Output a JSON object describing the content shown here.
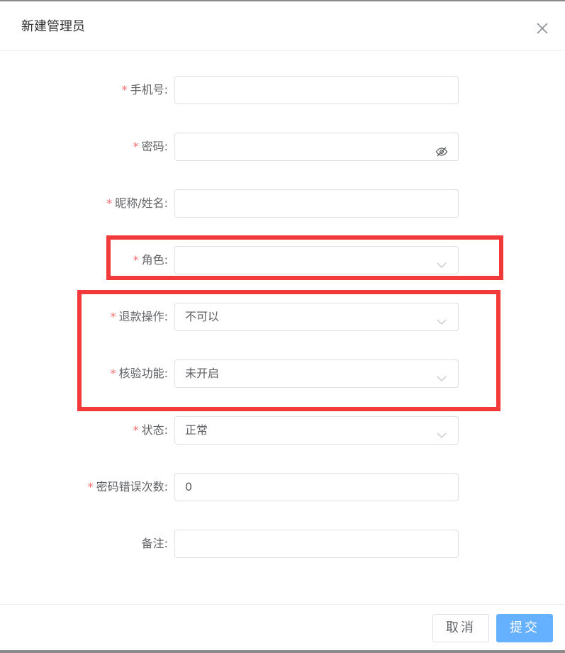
{
  "dialog": {
    "title": "新建管理员"
  },
  "form": {
    "phone": {
      "label": "手机号:",
      "required": true,
      "value": ""
    },
    "password": {
      "label": "密码:",
      "required": true,
      "value": ""
    },
    "nickname": {
      "label": "昵称/姓名:",
      "required": true,
      "value": ""
    },
    "role": {
      "label": "角色:",
      "required": true,
      "value": ""
    },
    "refund": {
      "label": "退款操作:",
      "required": true,
      "value": "不可以"
    },
    "verify": {
      "label": "核验功能:",
      "required": true,
      "value": "未开启"
    },
    "status": {
      "label": "状态:",
      "required": true,
      "value": "正常"
    },
    "pwd_errors": {
      "label": "密码错误次数:",
      "required": true,
      "value": "0"
    },
    "remark": {
      "label": "备注:",
      "required": false,
      "value": ""
    }
  },
  "footer": {
    "cancel_label": "取消",
    "submit_label": "提交"
  },
  "colors": {
    "required_star": "#f56c6c",
    "primary": "#66b1ff",
    "highlight": "#f23a3a"
  },
  "icons": {
    "close": "close-icon",
    "password_toggle": "eye-off-icon",
    "select_arrow": "chevron-down-icon"
  }
}
